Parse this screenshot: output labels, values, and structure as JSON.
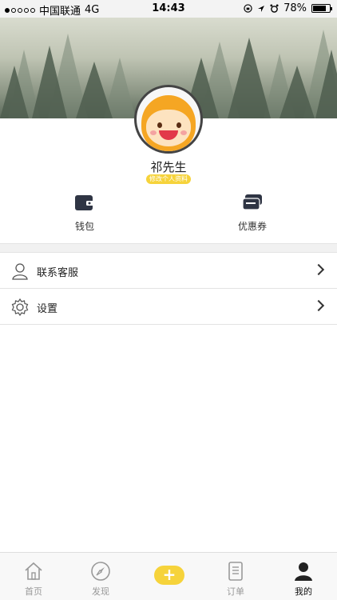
{
  "status_bar": {
    "carrier": "中国联通",
    "network": "4G",
    "time": "14:43",
    "battery": "78%",
    "battery_level": 0.78
  },
  "profile": {
    "username": "祁先生",
    "edit_label": "修改个人资料"
  },
  "actions": [
    {
      "label": "钱包",
      "icon": "wallet-icon"
    },
    {
      "label": "优惠券",
      "icon": "coupon-icon"
    }
  ],
  "menu": [
    {
      "label": "联系客服",
      "icon": "customer-service-icon"
    },
    {
      "label": "设置",
      "icon": "gear-icon"
    }
  ],
  "tabs": [
    {
      "label": "首页",
      "icon": "home-icon"
    },
    {
      "label": "发现",
      "icon": "compass-icon"
    },
    {
      "label": "+",
      "icon": "plus-icon"
    },
    {
      "label": "订单",
      "icon": "order-icon"
    },
    {
      "label": "我的",
      "icon": "user-icon",
      "active": true
    }
  ],
  "colors": {
    "accent": "#f6d33b",
    "text": "#222222",
    "tab_inactive": "#999999"
  }
}
